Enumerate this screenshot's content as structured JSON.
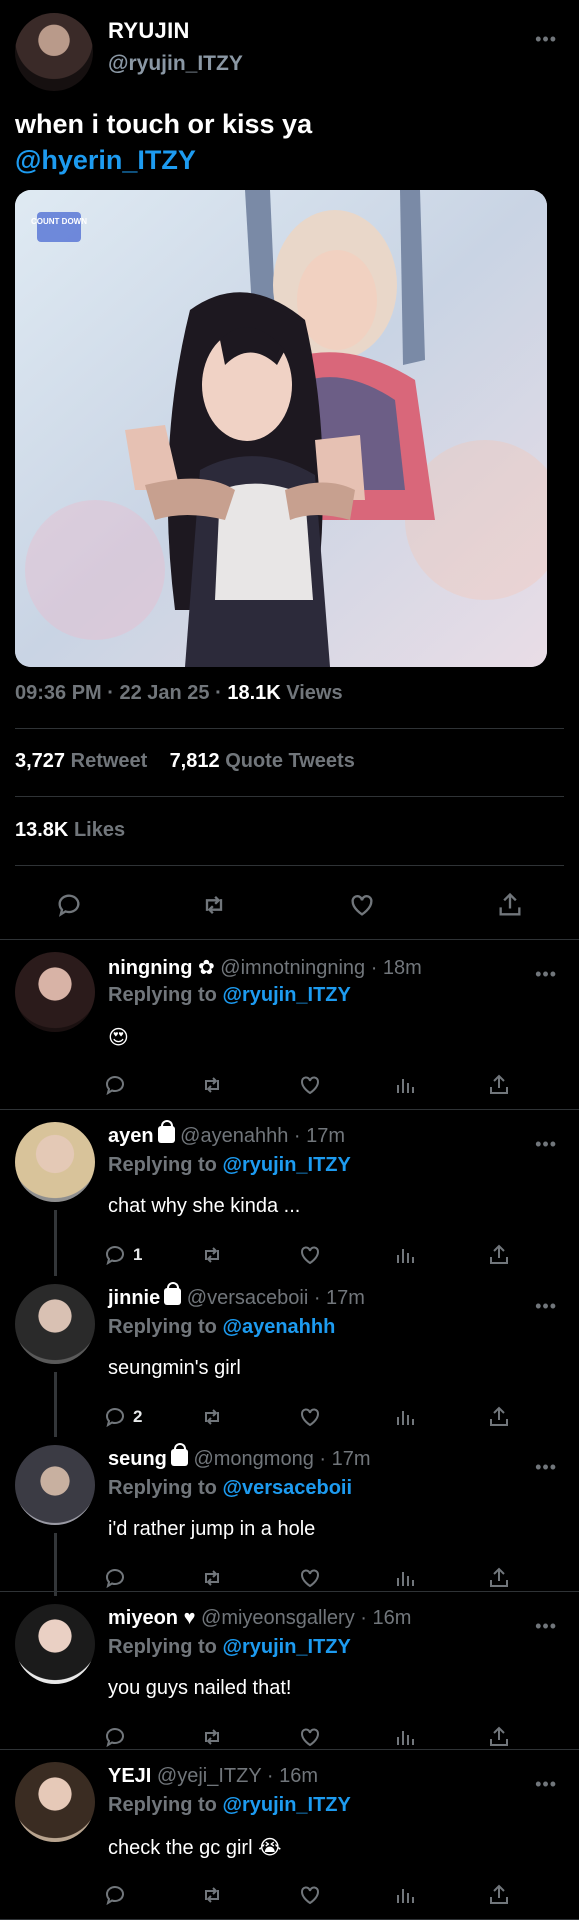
{
  "tweet": {
    "name": "RYUJIN",
    "handle": "@ryujin_ITZY",
    "text": "when i touch or kiss ya",
    "mention": "@hyerin_ITZY",
    "media_watermark": "COUNT DOWN",
    "time": "09:36 PM · 22 Jan 25 · ",
    "views_count": "18.1K",
    "views_label": "Views",
    "retweets_count": "3,727",
    "retweets_label": "Retweet",
    "quotes_count": "7,812",
    "quotes_label": "Quote Tweets",
    "likes_count": "13.8K",
    "likes_label": "Likes"
  },
  "replies": [
    {
      "name": "ningning ✿",
      "handle": "@imnotningning · 18m",
      "replying_prefix": "Replying to ",
      "replying_to": "@ryujin_ITZY",
      "text": "😍",
      "reply_count": ""
    },
    {
      "name": "ayen",
      "handle": "@ayenahhh · 17m",
      "replying_prefix": "Replying to ",
      "replying_to": "@ryujin_ITZY",
      "text": "chat why she kinda ...",
      "reply_count": "1"
    },
    {
      "name": "jinnie",
      "handle": "@versaceboii · 17m",
      "replying_prefix": "Replying to ",
      "replying_to": "@ayenahhh",
      "text": "seungmin's girl",
      "reply_count": "2"
    },
    {
      "name": "seung",
      "handle": "@mongmong · 17m",
      "replying_prefix": "Replying to ",
      "replying_to": "@versaceboii",
      "text": "i'd rather jump in a hole",
      "reply_count": ""
    },
    {
      "name": "miyeon ♥",
      "handle": "@miyeonsgallery · 16m",
      "replying_prefix": "Replying to ",
      "replying_to": "@ryujin_ITZY",
      "text": "you guys nailed that!",
      "reply_count": ""
    },
    {
      "name": "YEJI",
      "handle": "@yeji_ITZY · 16m",
      "replying_prefix": "Replying to ",
      "replying_to": "@ryujin_ITZY",
      "text": "check the gc girl 😭",
      "reply_count": ""
    }
  ],
  "icons": {
    "more": "more-icon",
    "reply": "reply-icon",
    "retweet": "retweet-icon",
    "like": "like-icon",
    "share": "share-icon",
    "views": "views-icon",
    "lock": "lock-icon"
  },
  "colors": {
    "background": "#000000",
    "accent": "#1d9bf0",
    "secondary": "#71767b",
    "divider": "#2f3336"
  }
}
